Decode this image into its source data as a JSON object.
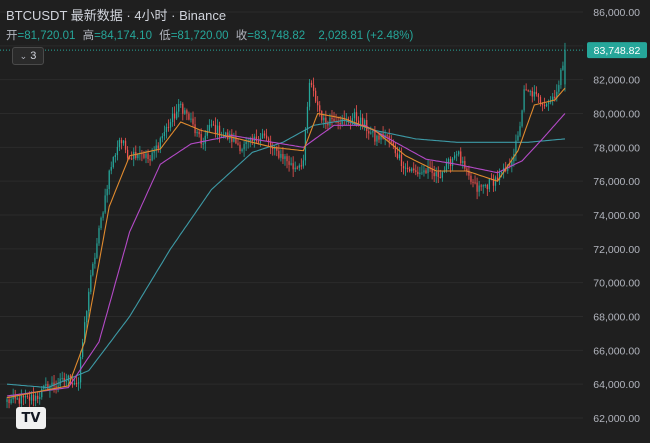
{
  "header": {
    "symbol": "BTCUSDT",
    "data_label": "最新数据",
    "interval": "4小时",
    "exchange": "Binance",
    "title_text": "BTCUSDT 最新数据 · 4小时 · Binance"
  },
  "ohlc": {
    "open_label": "开",
    "open": "=81,720.01",
    "high_label": "高",
    "high": "=84,174.10",
    "low_label": "低",
    "low": "=81,720.00",
    "close_label": "收",
    "close": "=83,748.82",
    "change": "2,028.81 (+2.48%)"
  },
  "indicators": {
    "count": "3"
  },
  "price_badge": "83,748.82",
  "colors": {
    "background": "#1f1f1f",
    "up": "#26a69a",
    "down": "#ef5350",
    "ma_short": "#e08a2e",
    "ma_mid": "#b44ac7",
    "ma_long": "#3d9aa6",
    "price_line": "#26a69a",
    "grid": "#2b2b2b",
    "axis_text": "#b2b5be"
  },
  "chart_data": {
    "type": "candlestick",
    "ylim": [
      61500,
      86500
    ],
    "y_ticks": [
      62000,
      64000,
      66000,
      68000,
      70000,
      72000,
      74000,
      76000,
      78000,
      80000,
      82000,
      84000,
      86000
    ],
    "y_tick_labels": [
      "62,000.00",
      "64,000.00",
      "66,000.00",
      "68,000.00",
      "70,000.00",
      "72,000.00",
      "74,000.00",
      "76,000.00",
      "78,000.00",
      "80,000.00",
      "82,000.00",
      "84,000.00",
      "86,000.00"
    ],
    "last_price": 83748.82,
    "grid": true,
    "close_path": [
      [
        0,
        63000
      ],
      [
        10,
        63100
      ],
      [
        15,
        63300
      ],
      [
        20,
        63900
      ],
      [
        25,
        64000
      ],
      [
        30,
        64300
      ],
      [
        35,
        64100
      ],
      [
        37,
        66500
      ],
      [
        40,
        69500
      ],
      [
        45,
        73000
      ],
      [
        50,
        76500
      ],
      [
        55,
        78500
      ],
      [
        60,
        77500
      ],
      [
        65,
        77800
      ],
      [
        70,
        77200
      ],
      [
        75,
        78500
      ],
      [
        80,
        79500
      ],
      [
        85,
        80500
      ],
      [
        90,
        79500
      ],
      [
        95,
        78200
      ],
      [
        100,
        79300
      ],
      [
        105,
        78800
      ],
      [
        110,
        78500
      ],
      [
        115,
        78000
      ],
      [
        120,
        78300
      ],
      [
        125,
        78800
      ],
      [
        130,
        77800
      ],
      [
        135,
        77500
      ],
      [
        140,
        76800
      ],
      [
        145,
        77200
      ],
      [
        148,
        81800
      ],
      [
        152,
        80500
      ],
      [
        155,
        79500
      ],
      [
        160,
        79800
      ],
      [
        165,
        79500
      ],
      [
        170,
        79800
      ],
      [
        175,
        79300
      ],
      [
        180,
        78500
      ],
      [
        185,
        78700
      ],
      [
        190,
        77800
      ],
      [
        195,
        76800
      ],
      [
        200,
        76500
      ],
      [
        205,
        76600
      ],
      [
        210,
        76300
      ],
      [
        215,
        76800
      ],
      [
        220,
        77800
      ],
      [
        225,
        76300
      ],
      [
        230,
        75500
      ],
      [
        235,
        75800
      ],
      [
        240,
        76200
      ],
      [
        245,
        76700
      ],
      [
        250,
        78500
      ],
      [
        253,
        81200
      ],
      [
        257,
        81200
      ],
      [
        260,
        80800
      ],
      [
        263,
        80700
      ],
      [
        266,
        80800
      ],
      [
        270,
        81600
      ],
      [
        273,
        83748
      ]
    ],
    "ma_short_points": [
      [
        0,
        63200
      ],
      [
        30,
        63900
      ],
      [
        38,
        66500
      ],
      [
        50,
        74500
      ],
      [
        60,
        77500
      ],
      [
        75,
        77900
      ],
      [
        85,
        79500
      ],
      [
        95,
        79000
      ],
      [
        110,
        78600
      ],
      [
        130,
        78000
      ],
      [
        145,
        77800
      ],
      [
        152,
        80000
      ],
      [
        165,
        79700
      ],
      [
        180,
        79000
      ],
      [
        195,
        77500
      ],
      [
        210,
        76600
      ],
      [
        225,
        76600
      ],
      [
        240,
        76000
      ],
      [
        250,
        77800
      ],
      [
        258,
        80500
      ],
      [
        268,
        80800
      ],
      [
        273,
        81500
      ]
    ],
    "ma_mid_points": [
      [
        0,
        63300
      ],
      [
        30,
        63800
      ],
      [
        45,
        66500
      ],
      [
        60,
        73000
      ],
      [
        75,
        77000
      ],
      [
        90,
        78200
      ],
      [
        110,
        78700
      ],
      [
        130,
        78300
      ],
      [
        145,
        78000
      ],
      [
        160,
        79300
      ],
      [
        175,
        79300
      ],
      [
        190,
        78300
      ],
      [
        205,
        77300
      ],
      [
        220,
        77000
      ],
      [
        240,
        76500
      ],
      [
        252,
        77200
      ],
      [
        262,
        78500
      ],
      [
        273,
        80000
      ]
    ],
    "ma_long_points": [
      [
        0,
        64000
      ],
      [
        20,
        63800
      ],
      [
        40,
        64800
      ],
      [
        60,
        68000
      ],
      [
        80,
        72000
      ],
      [
        100,
        75500
      ],
      [
        120,
        77700
      ],
      [
        135,
        78300
      ],
      [
        150,
        79300
      ],
      [
        165,
        79600
      ],
      [
        180,
        79000
      ],
      [
        200,
        78500
      ],
      [
        220,
        78300
      ],
      [
        240,
        78300
      ],
      [
        255,
        78300
      ],
      [
        273,
        78500
      ]
    ]
  }
}
